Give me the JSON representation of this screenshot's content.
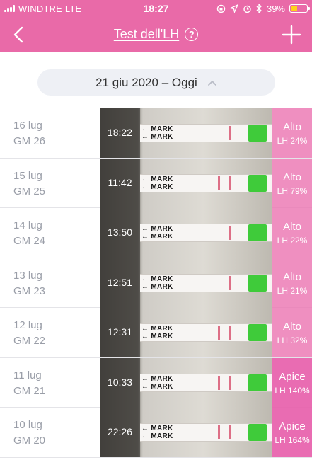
{
  "status_bar": {
    "carrier": "WINDTRE  LTE",
    "time": "18:27",
    "battery_percent": "39%",
    "battery_level": 0.39,
    "icons": [
      "signal-icon",
      "rotation-lock-icon",
      "location-icon",
      "alarm-icon",
      "bluetooth-icon",
      "battery-icon"
    ]
  },
  "nav": {
    "title": "Test dell'LH",
    "help_glyph": "?",
    "back_icon": "chevron-left-icon",
    "add_icon": "plus-icon"
  },
  "date_range": {
    "label": "21 giu 2020 – Oggi",
    "icon": "chevron-up-icon"
  },
  "tests": [
    {
      "date": "16 lug",
      "cycle_day": "GM 26",
      "time": "18:22",
      "level": "Alto",
      "lh": "LH 24%"
    },
    {
      "date": "15 lug",
      "cycle_day": "GM 25",
      "time": "11:42",
      "level": "Alto",
      "lh": "LH 79%"
    },
    {
      "date": "14 lug",
      "cycle_day": "GM 24",
      "time": "13:50",
      "level": "Alto",
      "lh": "LH 22%"
    },
    {
      "date": "13 lug",
      "cycle_day": "GM 23",
      "time": "12:51",
      "level": "Alto",
      "lh": "LH 21%"
    },
    {
      "date": "12 lug",
      "cycle_day": "GM 22",
      "time": "12:31",
      "level": "Alto",
      "lh": "LH 32%"
    },
    {
      "date": "11 lug",
      "cycle_day": "GM 21",
      "time": "10:33",
      "level": "Apice",
      "lh": "LH 140%"
    },
    {
      "date": "10 lug",
      "cycle_day": "GM 20",
      "time": "22:26",
      "level": "Apice",
      "lh": "LH 164%"
    }
  ],
  "strip_text": "MARK\nMARK",
  "colors": {
    "accent": "#e96aa8",
    "badge": "#ec76b2",
    "muted_text": "#9a9ea8",
    "control_line": "#d9607a",
    "strip_tab": "#3fcb3a"
  }
}
